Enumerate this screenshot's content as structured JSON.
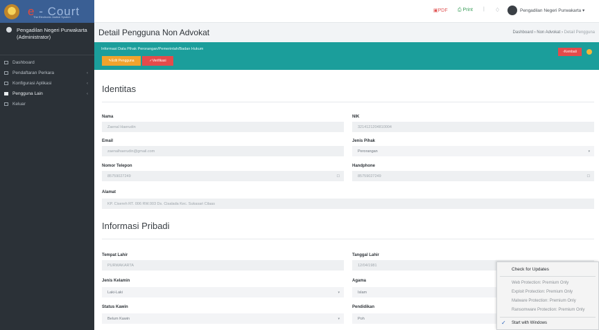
{
  "app": {
    "logo_text_e": "e",
    "logo_text_main": " - Court",
    "logo_sub": "The Electronic Justice System"
  },
  "sidebar": {
    "user_name": "Pengadilan Negeri Purwakarta",
    "user_role": "(Administrator)",
    "items": [
      {
        "label": "Dashboard"
      },
      {
        "label": "Pendaftaran Perkara"
      },
      {
        "label": "Konfigurasi Aplikasi"
      },
      {
        "label": "Pengguna Lain"
      },
      {
        "label": "Keluar"
      }
    ]
  },
  "topbar": {
    "pdf_label": "PDF",
    "print_label": "Print",
    "separator": "|",
    "user_label": "Pengadilan Negeri Purwakarta"
  },
  "header": {
    "title": "Detail Pengguna Non Advokat",
    "breadcrumb": [
      "Dashboard",
      "Non Advokat",
      "Detail Pengguna"
    ]
  },
  "banner": {
    "title": "Informasi Data Pihak Perorangan/Pemerintah/Badan Hukum",
    "edit_label": "Edit Pengguna",
    "verify_label": "Verifikasi",
    "back_label": "Kembali"
  },
  "identitas": {
    "heading": "Identitas",
    "nama_label": "Nama",
    "nama_value": "Zaenal Haerudin",
    "nik_label": "NIK",
    "nik_value": "3214121204810004",
    "email_label": "Email",
    "email_value": "zaenalhaerudin@gmail.com",
    "jenis_pihak_label": "Jenis Pihak",
    "jenis_pihak_value": "Perorangan",
    "telepon_label": "Nomor Telepon",
    "telepon_value": "85759027249",
    "handphone_label": "Handphone",
    "handphone_value": "85759027249",
    "alamat_label": "Alamat",
    "alamat_value": "KP. Cisereh RT. 006 RW.003 Ds. Cisalada Kec. Sukasari Cilaas"
  },
  "pribadi": {
    "heading": "Informasi Pribadi",
    "tempat_lahir_label": "Tempat Lahir",
    "tempat_lahir_value": "PURWAKARTA",
    "tanggal_lahir_label": "Tanggal Lahir",
    "tanggal_lahir_value": "12/04/1981",
    "jenis_kelamin_label": "Jenis Kelamin",
    "jenis_kelamin_value": "Laki-Laki",
    "agama_label": "Agama",
    "agama_value": "Islam",
    "status_kawin_label": "Status Kawin",
    "status_kawin_value": "Belum Kawin",
    "pendidikan_label": "Pendidikan",
    "pendidikan_value": "Poh"
  },
  "popup": {
    "check_updates": "Check for Updates",
    "web_protection": "Web Protection: Premium Only",
    "exploit_protection": "Exploit Protection: Premium Only",
    "malware_protection": "Malware Protection: Premium Only",
    "ransomware_protection": "Ransomware Protection: Premium Only",
    "start_with_windows": "Start with Windows"
  }
}
